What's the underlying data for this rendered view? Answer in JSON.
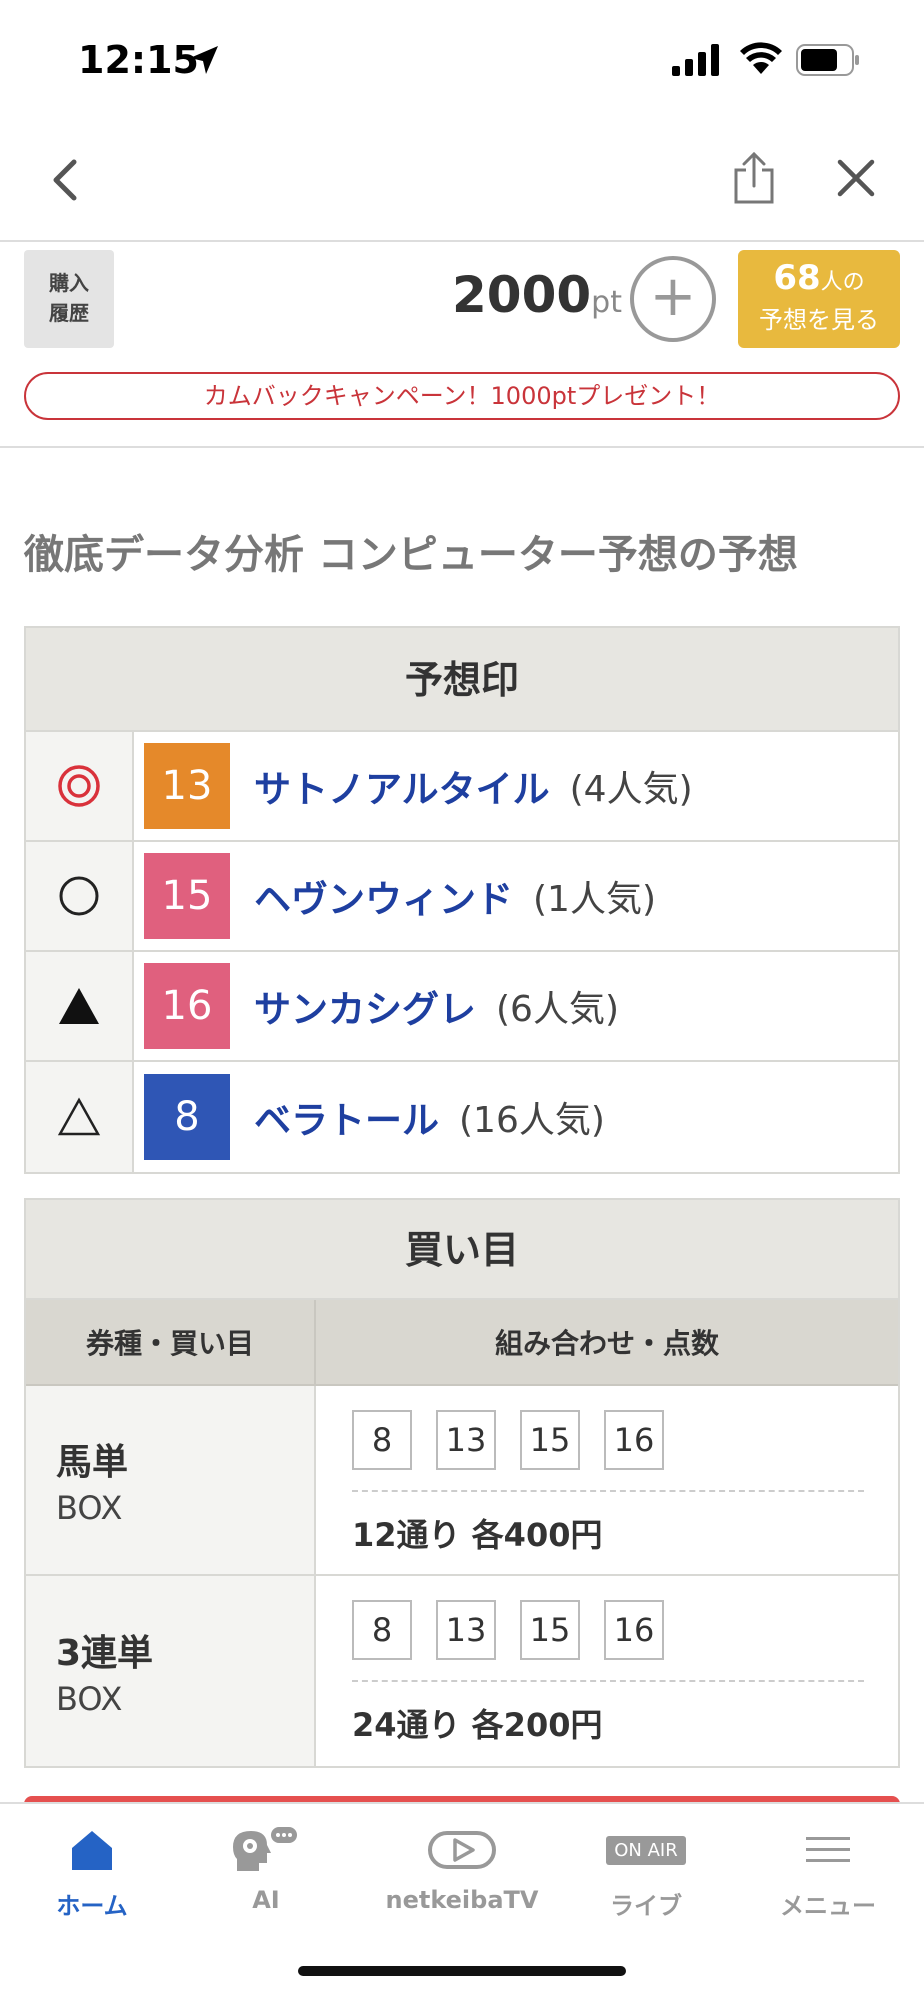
{
  "status_bar": {
    "time": "12:15"
  },
  "points": {
    "history_line1": "購入",
    "history_line2": "履歴",
    "value": "2000",
    "unit": "pt",
    "plus": "+",
    "predictors_count": "68",
    "predictors_suffix": "人の",
    "predictors_line2": "予想を見る"
  },
  "campaign": "カムバックキャンペーン！1000ptプレゼント！",
  "section_title": "徹底データ分析 コンピューター予想の予想",
  "marks": {
    "header": "予想印",
    "rows": [
      {
        "mark": "◎",
        "number": "13",
        "color": "#e5892a",
        "name": "サトノアルタイル",
        "popularity": "(4人気)"
      },
      {
        "mark": "○",
        "number": "15",
        "color": "#e0607e",
        "name": "ヘヴンウィンド",
        "popularity": "(1人気)"
      },
      {
        "mark": "▲",
        "number": "16",
        "color": "#e0607e",
        "name": "サンカシグレ",
        "popularity": "(6人気)"
      },
      {
        "mark": "△",
        "number": "8",
        "color": "#2f56b5",
        "name": "ベラトール",
        "popularity": "(16人気)"
      }
    ]
  },
  "bets": {
    "header": "買い目",
    "col1": "券種・買い目",
    "col2": "組み合わせ・点数",
    "rows": [
      {
        "type": "馬単",
        "sub": "BOX",
        "numbers": [
          "8",
          "13",
          "15",
          "16"
        ],
        "summary": "12通り 各400円"
      },
      {
        "type": "3連単",
        "sub": "BOX",
        "numbers": [
          "8",
          "13",
          "15",
          "16"
        ],
        "summary": "24通り 各200円"
      }
    ]
  },
  "tabbar": {
    "home": "ホーム",
    "ai": "AI",
    "tv": "netkeibaTV",
    "onair": "ON AIR",
    "live": "ライブ",
    "menu": "メニュー"
  }
}
